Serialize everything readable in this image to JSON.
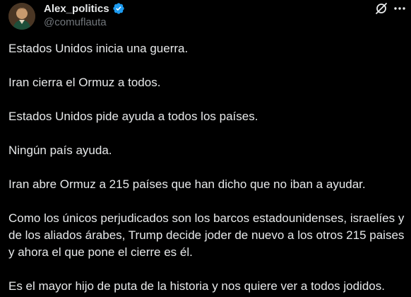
{
  "author": {
    "display_name": "Alex_politics",
    "handle": "@comuflauta",
    "verified": true,
    "avatar_icon": "avatar-portrait",
    "verified_icon": "verified-badge-icon",
    "verified_color": "#1d9bf0"
  },
  "actions": {
    "grok_icon": "grok-icon",
    "more_icon": "more-options-icon"
  },
  "tweet": {
    "paragraphs": [
      "Estados Unidos inicia una guerra.",
      "Iran cierra el Ormuz a todos.",
      "Estados Unidos pide ayuda a todos los países.",
      "Ningún país ayuda.",
      "Iran abre Ormuz a 215 países que han dicho que no iban a ayudar.",
      "Como los únicos perjudicados son los barcos estadounidenses, israelíes y de los aliados árabes, Trump decide joder de nuevo a los otros 215 paises y ahora el que pone el cierre es él.",
      "Es el mayor hijo de puta de la historia y nos quiere ver a todos jodidos."
    ]
  },
  "colors": {
    "background": "#000000",
    "text_primary": "#e7e9ea",
    "text_secondary": "#71767b"
  }
}
